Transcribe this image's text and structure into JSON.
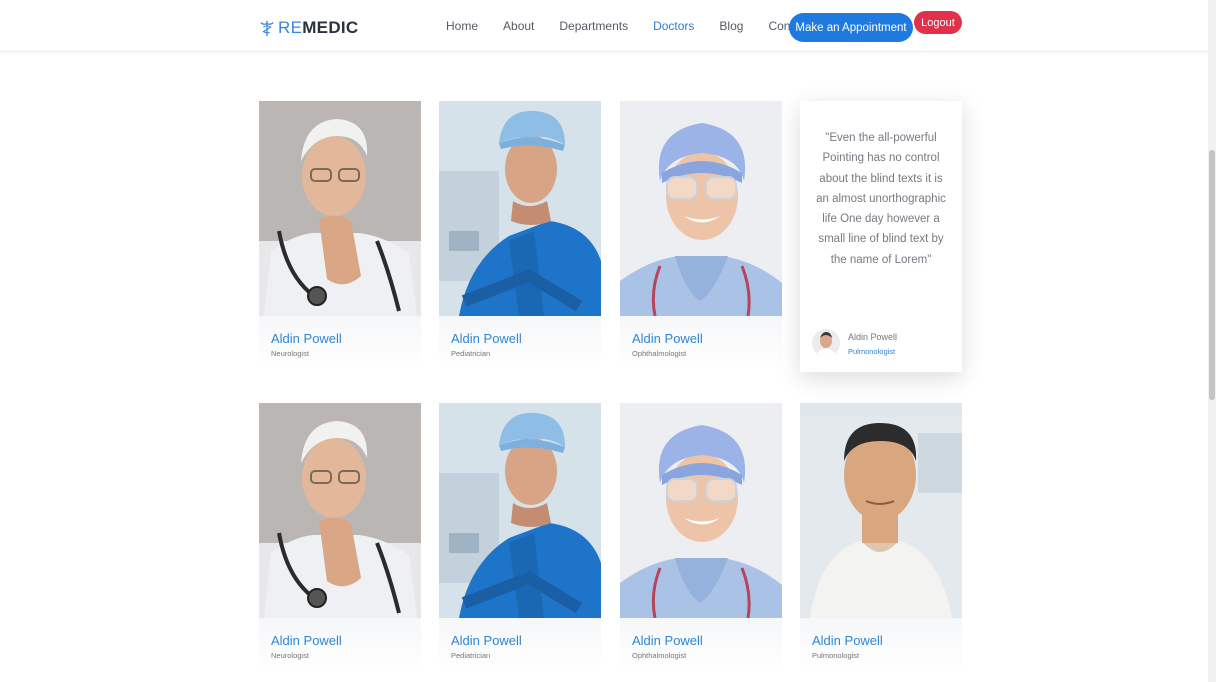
{
  "brand": {
    "part1": "RE",
    "part2": "MEDIC",
    "accent_color": "#3a86d6",
    "dark_color": "#2a3140"
  },
  "nav": {
    "items": [
      {
        "label": "Home",
        "active": false
      },
      {
        "label": "About",
        "active": false
      },
      {
        "label": "Departments",
        "active": false
      },
      {
        "label": "Doctors",
        "active": true
      },
      {
        "label": "Blog",
        "active": false
      },
      {
        "label": "Contact",
        "active": false
      }
    ],
    "appointment_label": "Make an Appointment",
    "logout_label": "Logout",
    "primary_color": "#1f7ae0",
    "logout_color": "#e0304a"
  },
  "doctors": [
    {
      "name": "Aldin Powell",
      "specialty": "Neurologist",
      "photo": "elderly-doctor-photo"
    },
    {
      "name": "Aldin Powell",
      "specialty": "Pediatrician",
      "photo": "surgeon-photo"
    },
    {
      "name": "Aldin Powell",
      "specialty": "Ophthalmologist",
      "photo": "nurse-photo"
    },
    {
      "name": "Aldin Powell",
      "specialty": "Neurologist",
      "photo": "elderly-doctor-photo"
    },
    {
      "name": "Aldin Powell",
      "specialty": "Pediatrician",
      "photo": "surgeon-photo"
    },
    {
      "name": "Aldin Powell",
      "specialty": "Ophthalmologist",
      "photo": "nurse-photo"
    },
    {
      "name": "Aldin Powell",
      "specialty": "Pulmonologist",
      "photo": "young-doctor-photo"
    }
  ],
  "testimonial": {
    "quote": "\"Even the all-powerful Pointing has no control about the blind texts it is an almost unorthographic life One day however a small line of blind text by the name of Lorem\"",
    "author": "Aldin Powell",
    "specialty": "Pulmonologist"
  }
}
